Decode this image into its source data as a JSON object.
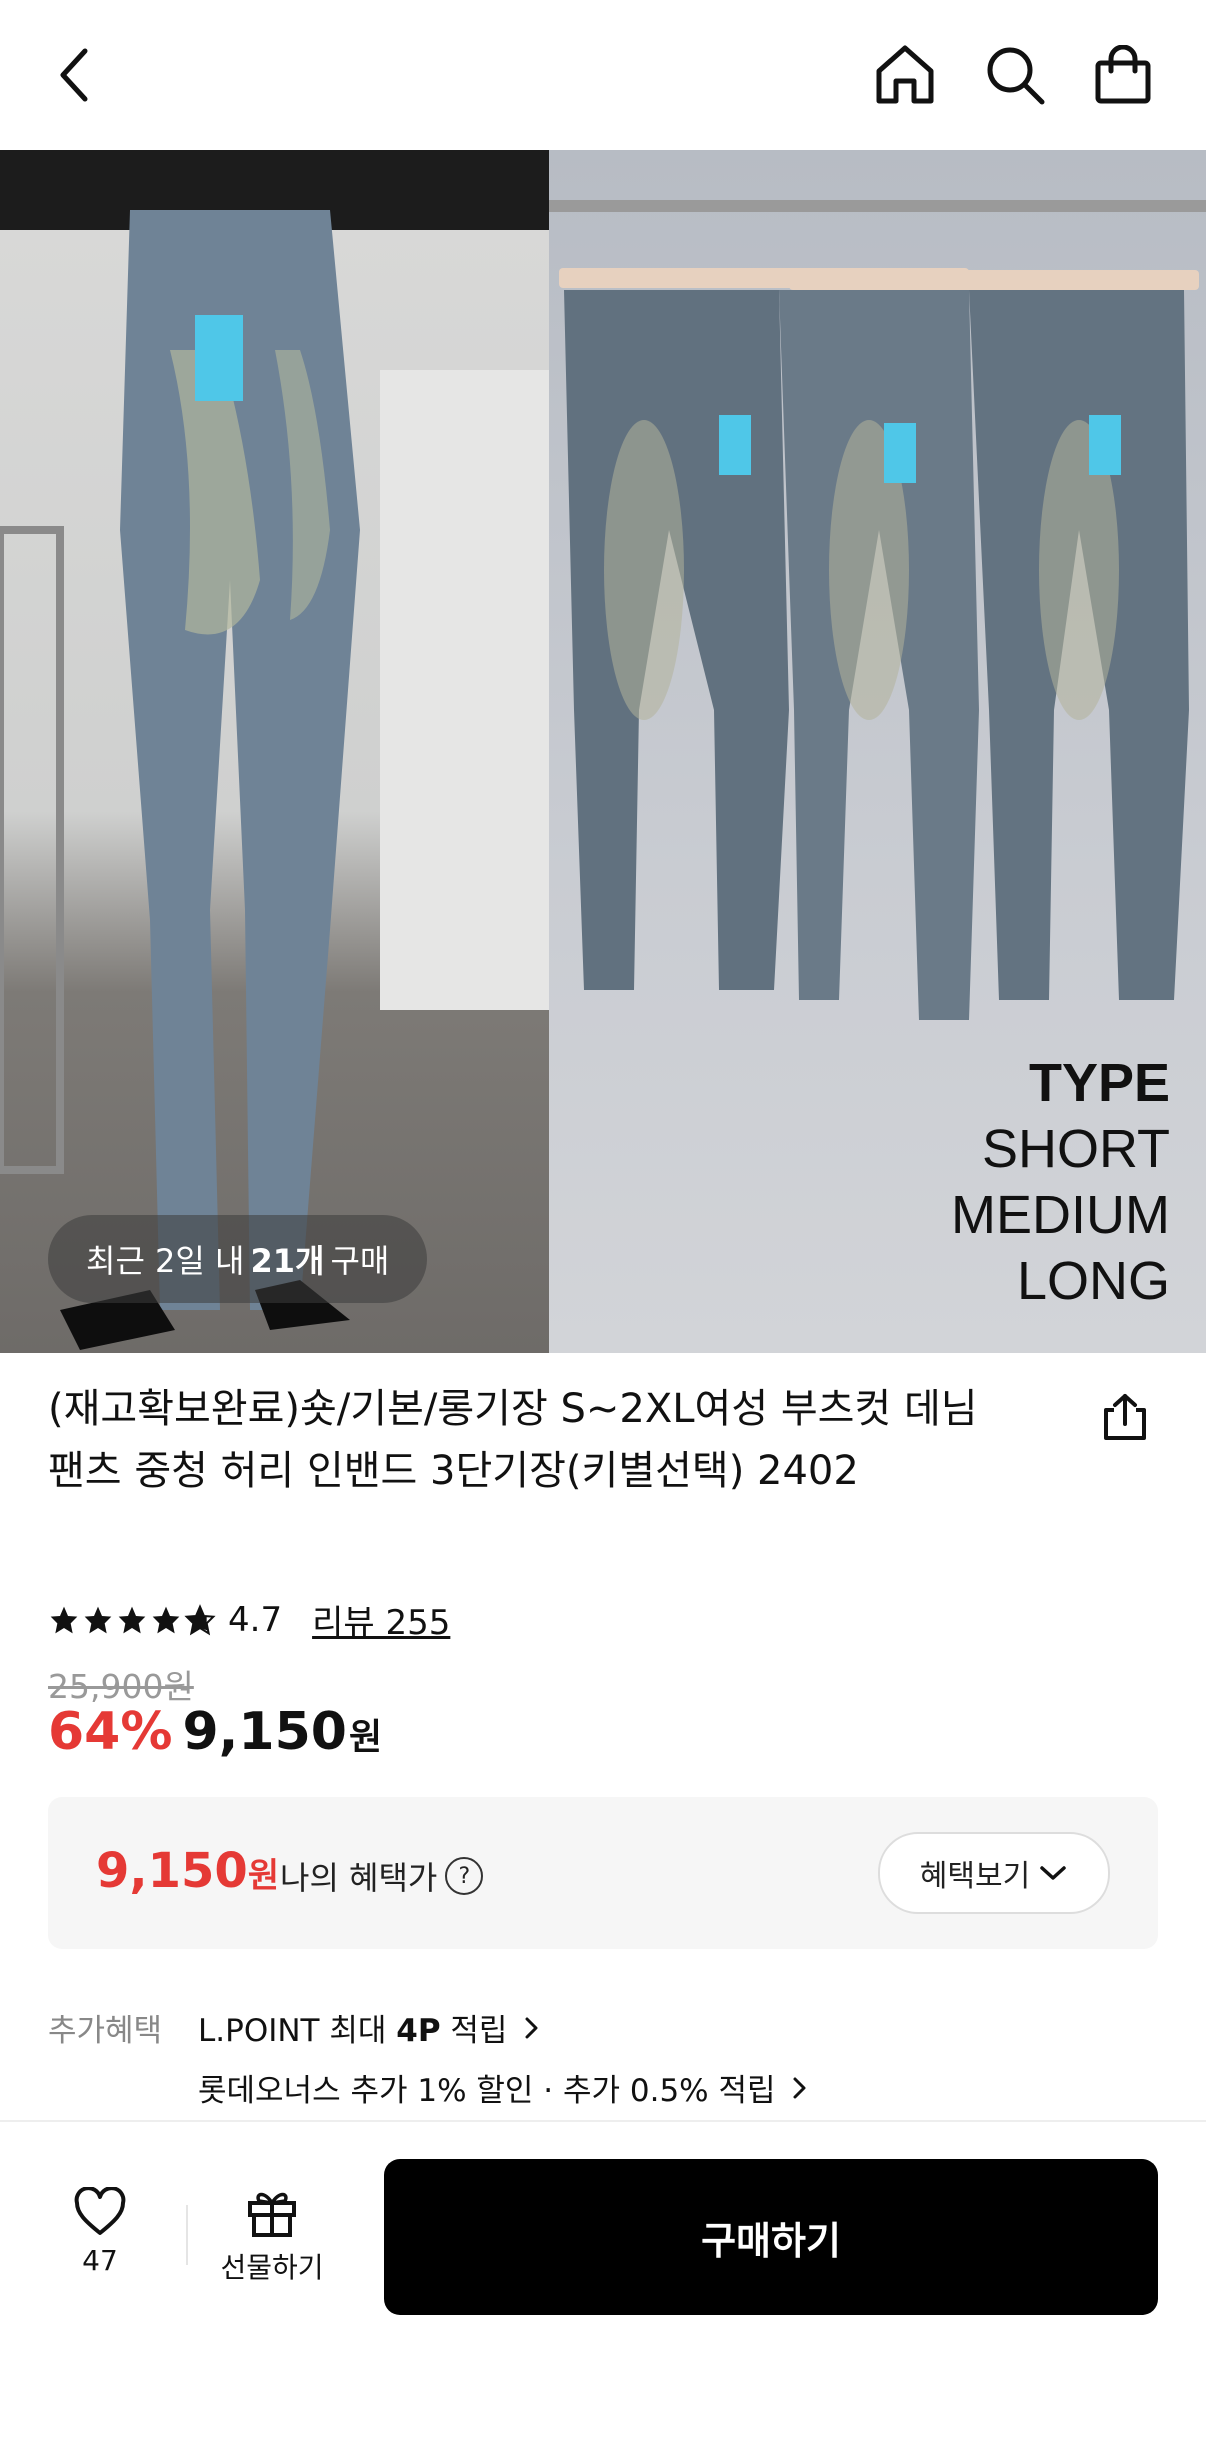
{
  "header": {
    "back_icon": "chevron-left-icon",
    "home_icon": "home-icon",
    "search_icon": "search-icon",
    "cart_icon": "shopping-bag-icon"
  },
  "hero": {
    "recent_prefix": "최근 2일 내",
    "recent_count": "21개",
    "recent_suffix": "구매",
    "type_title": "TYPE",
    "type_options": [
      "SHORT",
      "MEDIUM",
      "LONG"
    ]
  },
  "product": {
    "title": "(재고확보완료)숏/기본/롱기장 S~2XL여성 부츠컷 데님 팬츠 중청 허리 인밴드 3단기장(키별선택) 2402",
    "rating": "4.7",
    "review_label": "리뷰 255",
    "original_price": "25,900원",
    "discount": "64%",
    "price": "9,150",
    "currency": "원"
  },
  "benefit": {
    "price": "9,150",
    "currency": "원",
    "label": "나의 혜택가",
    "button_label": "혜택보기"
  },
  "extra": {
    "label": "추가혜택",
    "line1_prefix": "L.POINT 최대",
    "line1_bold": "4P",
    "line1_suffix": "적립",
    "line2": "롯데오너스 추가 1% 할인 · 추가 0.5% 적립"
  },
  "bottom": {
    "like_count": "47",
    "gift_label": "선물하기",
    "buy_label": "구매하기"
  },
  "colors": {
    "accent_red": "#e53935",
    "buy_button": "#000000"
  }
}
